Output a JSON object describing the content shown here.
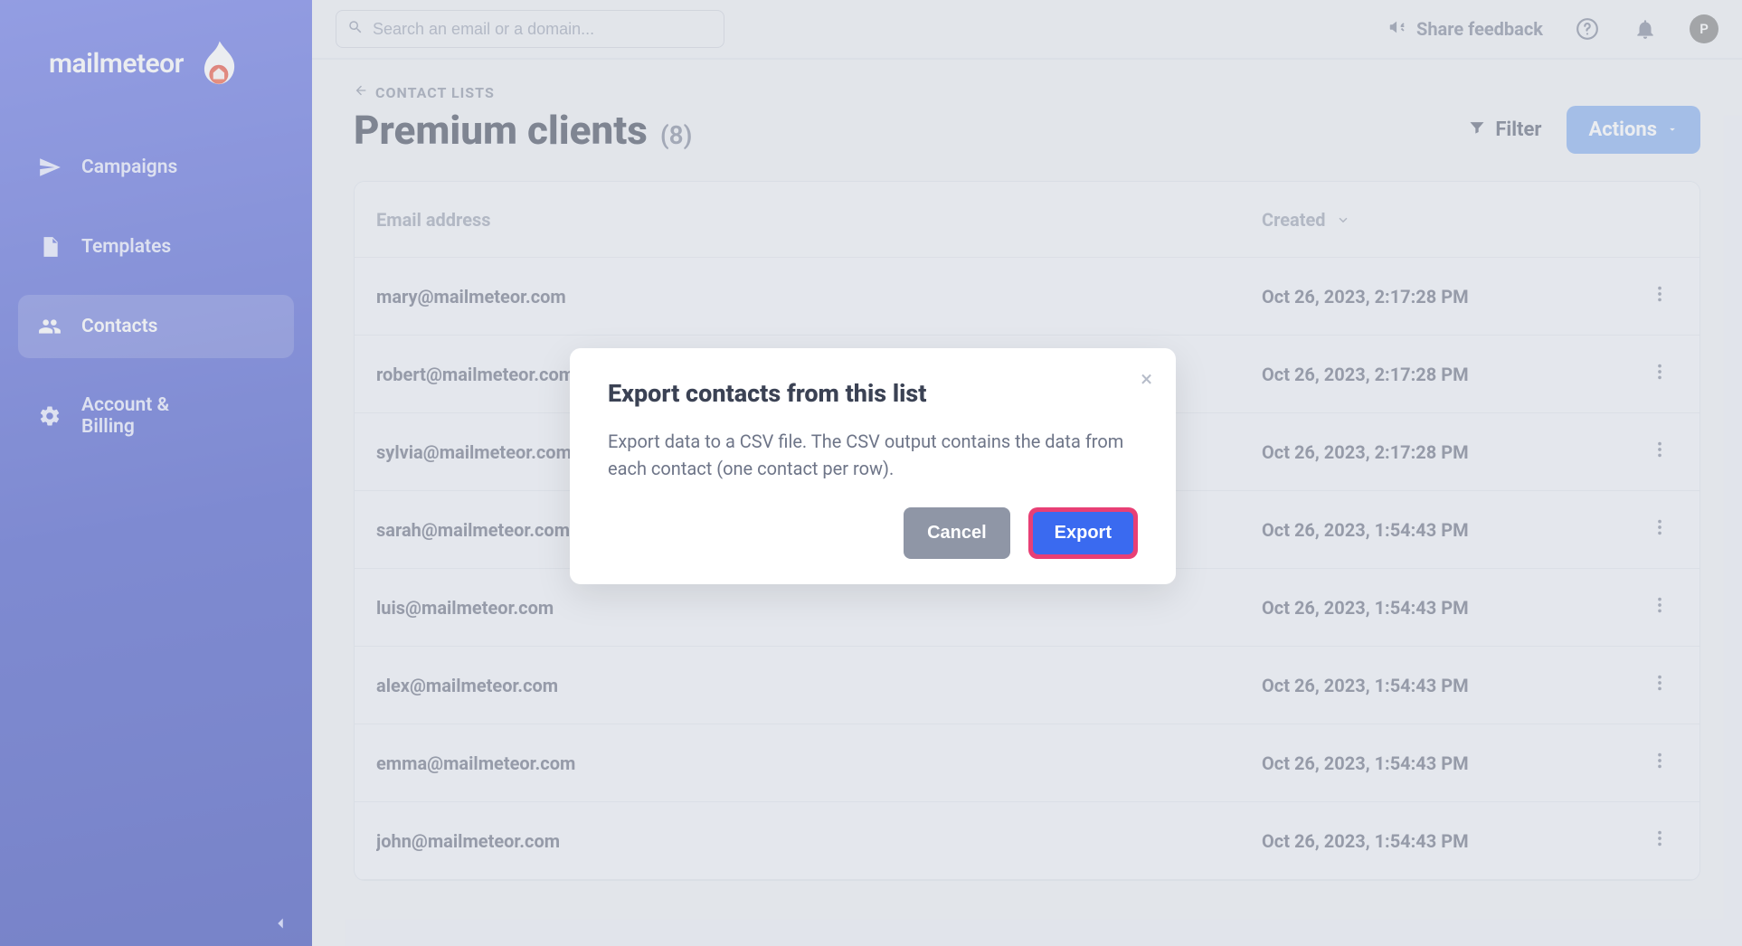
{
  "brand": {
    "name": "mailmeteor"
  },
  "sidebar": {
    "items": [
      {
        "label": "Campaigns"
      },
      {
        "label": "Templates"
      },
      {
        "label": "Contacts"
      },
      {
        "label": "Account & Billing"
      }
    ]
  },
  "topbar": {
    "search_placeholder": "Search an email or a domain...",
    "share_feedback": "Share feedback",
    "avatar_initial": "P"
  },
  "breadcrumb": {
    "label": "CONTACT LISTS"
  },
  "page": {
    "title": "Premium clients",
    "count_label": "(8)",
    "filter_label": "Filter",
    "actions_label": "Actions"
  },
  "table": {
    "headers": {
      "email": "Email address",
      "created": "Created"
    },
    "rows": [
      {
        "email": "mary@mailmeteor.com",
        "created": "Oct 26, 2023, 2:17:28 PM"
      },
      {
        "email": "robert@mailmeteor.com",
        "created": "Oct 26, 2023, 2:17:28 PM"
      },
      {
        "email": "sylvia@mailmeteor.com",
        "created": "Oct 26, 2023, 2:17:28 PM"
      },
      {
        "email": "sarah@mailmeteor.com",
        "created": "Oct 26, 2023, 1:54:43 PM"
      },
      {
        "email": "luis@mailmeteor.com",
        "created": "Oct 26, 2023, 1:54:43 PM"
      },
      {
        "email": "alex@mailmeteor.com",
        "created": "Oct 26, 2023, 1:54:43 PM"
      },
      {
        "email": "emma@mailmeteor.com",
        "created": "Oct 26, 2023, 1:54:43 PM"
      },
      {
        "email": "john@mailmeteor.com",
        "created": "Oct 26, 2023, 1:54:43 PM"
      }
    ]
  },
  "modal": {
    "title": "Export contacts from this list",
    "body": "Export data to a CSV file. The CSV output contains the data from each contact (one contact per row).",
    "cancel_label": "Cancel",
    "export_label": "Export"
  }
}
